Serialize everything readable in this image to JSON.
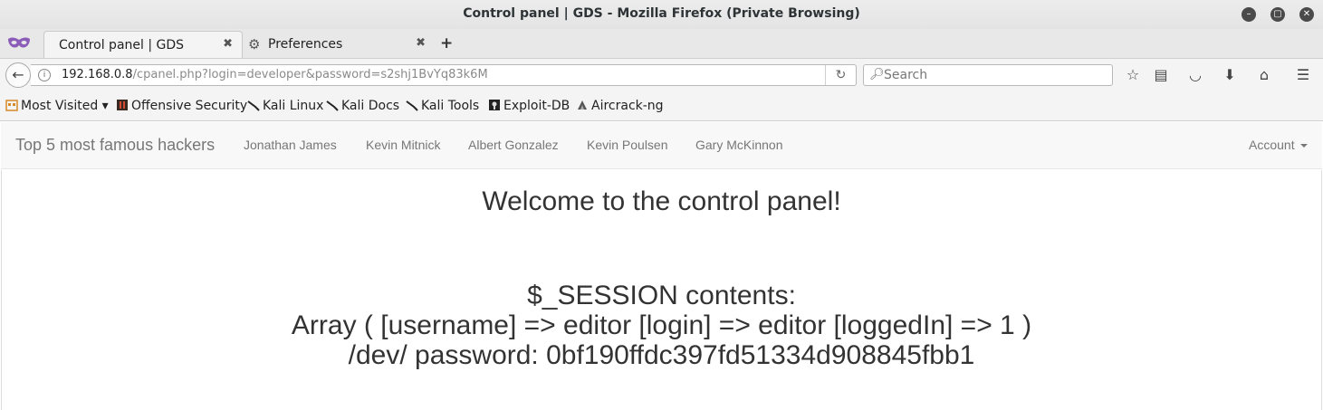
{
  "window": {
    "title": "Control panel | GDS - Mozilla Firefox (Private Browsing)"
  },
  "tabs": [
    {
      "label": "Control panel | GDS",
      "active": true
    },
    {
      "label": "Preferences",
      "active": false,
      "icon": "gear-icon"
    }
  ],
  "navbar": {
    "url_host": "192.168.0.8",
    "url_path": "/cpanel.php?login=developer&password=s2shj1BvYq83k6M",
    "search_placeholder": "Search"
  },
  "bookmarks": [
    {
      "label": "Most Visited ▾",
      "icon": "most-visited-icon"
    },
    {
      "label": "Offensive Security",
      "icon": "offsec-icon"
    },
    {
      "label": "Kali Linux",
      "icon": "kali-icon"
    },
    {
      "label": "Kali Docs",
      "icon": "kali-icon"
    },
    {
      "label": "Kali Tools",
      "icon": "kali-icon"
    },
    {
      "label": "Exploit-DB",
      "icon": "exploitdb-icon"
    },
    {
      "label": "Aircrack-ng",
      "icon": "aircrack-icon"
    }
  ],
  "site": {
    "brand": "Top 5 most famous hackers",
    "links": [
      "Jonathan James",
      "Kevin Mitnick",
      "Albert Gonzalez",
      "Kevin Poulsen",
      "Gary McKinnon"
    ],
    "account": "Account"
  },
  "main": {
    "heading": "Welcome to the control panel!",
    "session_title": "$_SESSION contents:",
    "session_array": "Array ( [username] => editor [login] => editor [loggedIn] => 1 )",
    "dev_password": "/dev/ password: 0bf190ffdc397fd51334d908845fbb1"
  }
}
